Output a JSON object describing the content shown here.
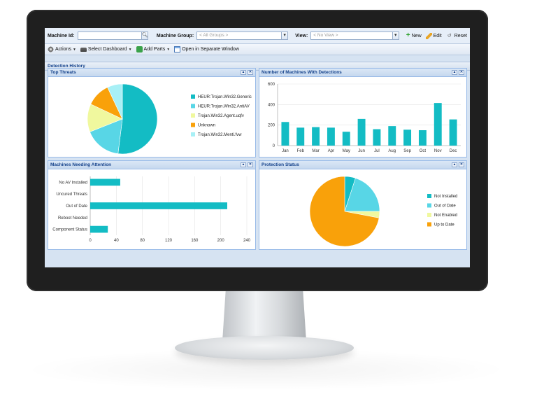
{
  "filters": {
    "machine_id_label": "Machine Id:",
    "machine_id_value": "",
    "machine_group_label": "Machine Group:",
    "machine_group_value": "< All Groups >",
    "view_label": "View:",
    "view_value": "< No View >",
    "new_label": "New",
    "edit_label": "Edit",
    "reset_label": "Reset"
  },
  "toolbar": {
    "actions_label": "Actions",
    "select_dashboard_label": "Select Dashboard",
    "add_parts_label": "Add Parts",
    "open_window_label": "Open in Separate Window"
  },
  "section_title": "Detection History",
  "colors": {
    "teal": "#13bcc4",
    "light_blue": "#58d6e6",
    "pale_yellow": "#f0f89e",
    "orange": "#f9a10a",
    "pale_cyan": "#a8f0f6",
    "header_text": "#15428b"
  },
  "panels": {
    "top_threats": {
      "title": "Top Threats",
      "chart_data": {
        "type": "pie",
        "labels": [
          "HEUR:Trojan.Win32.Generic",
          "HEUR:Trojan.Win32.AntiAV",
          "Trojan.Win32.Agent.uqfv",
          "Unknown",
          "Trojan.Win32.Menti.fvw"
        ],
        "values": [
          52,
          17,
          13,
          11,
          7
        ],
        "colors": [
          "#13bcc4",
          "#58d6e6",
          "#f0f89e",
          "#f9a10a",
          "#a8f0f6"
        ],
        "legend_position": "right"
      }
    },
    "machines_with_detections": {
      "title": "Number of Machines With Detections",
      "chart_data": {
        "type": "bar",
        "categories": [
          "Jan",
          "Feb",
          "Mar",
          "Apr",
          "May",
          "Jun",
          "Jul",
          "Aug",
          "Sep",
          "Oct",
          "Nov",
          "Dec"
        ],
        "values": [
          230,
          175,
          180,
          175,
          135,
          260,
          160,
          190,
          155,
          150,
          415,
          255
        ],
        "ylim": [
          0,
          600
        ],
        "yticks": [
          0,
          200,
          400,
          600
        ],
        "color": "#13bcc4",
        "grid": true
      }
    },
    "machines_needing_attention": {
      "title": "Machines Needing Attention",
      "chart_data": {
        "type": "bar",
        "orientation": "horizontal",
        "categories": [
          "No AV Installed",
          "Uncured Threats",
          "Out of Date",
          "Reboot Needed",
          "Component Status"
        ],
        "values": [
          46,
          0,
          210,
          0,
          27
        ],
        "xlim": [
          0,
          240
        ],
        "xticks": [
          0,
          40,
          80,
          120,
          160,
          200,
          240
        ],
        "color": "#13bcc4",
        "grid": true
      }
    },
    "protection_status": {
      "title": "Protection Status",
      "chart_data": {
        "type": "pie",
        "labels": [
          "Not Installed",
          "Out of Date",
          "Not Enabled",
          "Up to Date"
        ],
        "values": [
          5,
          20,
          3,
          72
        ],
        "colors": [
          "#13bcc4",
          "#58d6e6",
          "#f0f89e",
          "#f9a10a"
        ],
        "legend_position": "right"
      }
    }
  }
}
